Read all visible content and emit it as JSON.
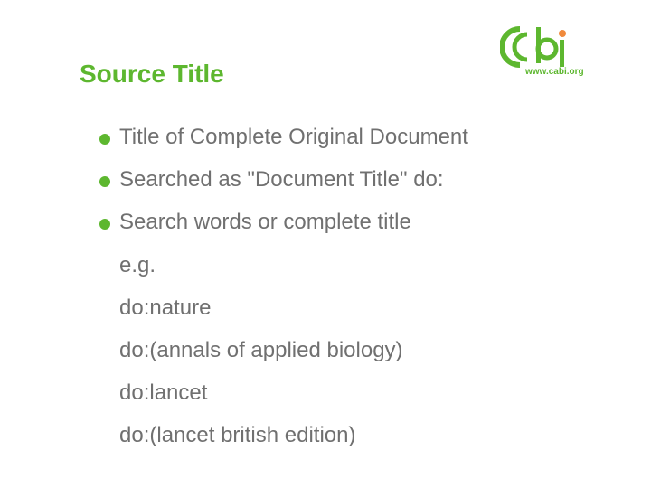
{
  "slide": {
    "title": "Source Title",
    "logo": {
      "text": "www.cabi.org",
      "brand_color": "#5db72f",
      "accent_color": "#f08a3c"
    },
    "bullets": [
      "Title of Complete Original Document",
      "Searched as \"Document Title\" do:",
      "Search words or complete title"
    ],
    "examples": [
      "e.g.",
      "do:nature",
      "do:(annals of applied biology)",
      "do:lancet",
      "do:(lancet british edition)"
    ],
    "colors": {
      "heading": "#5db72f",
      "bullet": "#5db72f",
      "text": "#707070"
    }
  }
}
